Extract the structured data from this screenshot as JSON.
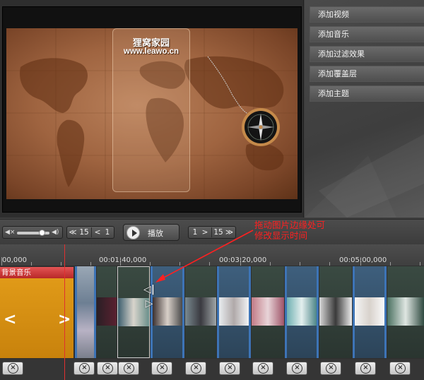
{
  "preview": {
    "site_name": "狸窝家园",
    "site_url": "www.leawo.cn"
  },
  "menu": {
    "items": [
      "添加视频",
      "添加音乐",
      "添加过滤效果",
      "添加覆盖层",
      "添加主题"
    ]
  },
  "controls": {
    "skip_back_count": "15",
    "step_back_count": "1",
    "play_label": "播放",
    "step_forward_count": "1",
    "skip_forward_count": "15"
  },
  "annotation": {
    "line1": "拖动图片边缘处可",
    "line2": "修改显示时间"
  },
  "timeline": {
    "time_labels": [
      "00,000",
      "00:01:40,000",
      "00:03:20,000",
      "00:05:00,000"
    ],
    "music_track_label": "背景音乐"
  },
  "colors": {
    "accent_red": "#ff2020",
    "music_clip": "#d48b12",
    "clip_border_blue": "#3d74b6"
  }
}
